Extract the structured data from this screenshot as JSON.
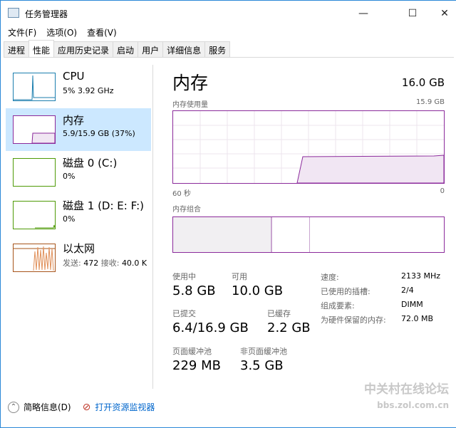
{
  "window": {
    "title": "任务管理器",
    "controls": [
      "—",
      "☐",
      "✕"
    ]
  },
  "menu": [
    "文件(F)",
    "选项(O)",
    "查看(V)"
  ],
  "tabs": [
    "进程",
    "性能",
    "应用历史记录",
    "启动",
    "用户",
    "详细信息",
    "服务"
  ],
  "active_tab": 1,
  "sidebar": [
    {
      "name": "CPU",
      "sub": "5% 3.92 GHz",
      "color": "#1b7eae"
    },
    {
      "name": "内存",
      "sub": "5.9/15.9 GB (37%)",
      "color": "#8b2a9b",
      "selected": true
    },
    {
      "name": "磁盘 0 (C:)",
      "sub": "0%",
      "color": "#4e9a06"
    },
    {
      "name": "磁盘 1 (D: E: F:)",
      "sub": "0%",
      "color": "#4e9a06"
    },
    {
      "name": "以太网",
      "sub_k1": "发送:",
      "sub_v1": "472",
      "sub_k2": "接收:",
      "sub_v2": "40.0 K",
      "color": "#a7541a"
    }
  ],
  "main": {
    "title": "内存",
    "total": "16.0 GB",
    "usage_label": "内存使用量",
    "usage_max": "15.9 GB",
    "axis_left": "60 秒",
    "axis_right": "0",
    "composition_label": "内存组合",
    "usage_fraction_now": 0.37,
    "stats": {
      "in_use_label": "使用中",
      "in_use": "5.8 GB",
      "available_label": "可用",
      "available": "10.0 GB",
      "committed_label": "已提交",
      "committed": "6.4/16.9 GB",
      "cached_label": "已缓存",
      "cached": "2.2 GB",
      "paged_label": "页面缓冲池",
      "paged": "229 MB",
      "nonpaged_label": "非页面缓冲池",
      "nonpaged": "3.5 GB"
    },
    "details": [
      {
        "k": "速度:",
        "v": "2133 MHz"
      },
      {
        "k": "已使用的插槽:",
        "v": "2/4"
      },
      {
        "k": "组成要素:",
        "v": "DIMM"
      },
      {
        "k": "为硬件保留的内存:",
        "v": "72.0 MB"
      }
    ]
  },
  "footer": {
    "fewer_details": "简略信息(D)",
    "open_monitor": "打开资源监视器"
  },
  "watermark": {
    "title": "中关村在线论坛",
    "url": "bbs.zol.com.cn"
  }
}
